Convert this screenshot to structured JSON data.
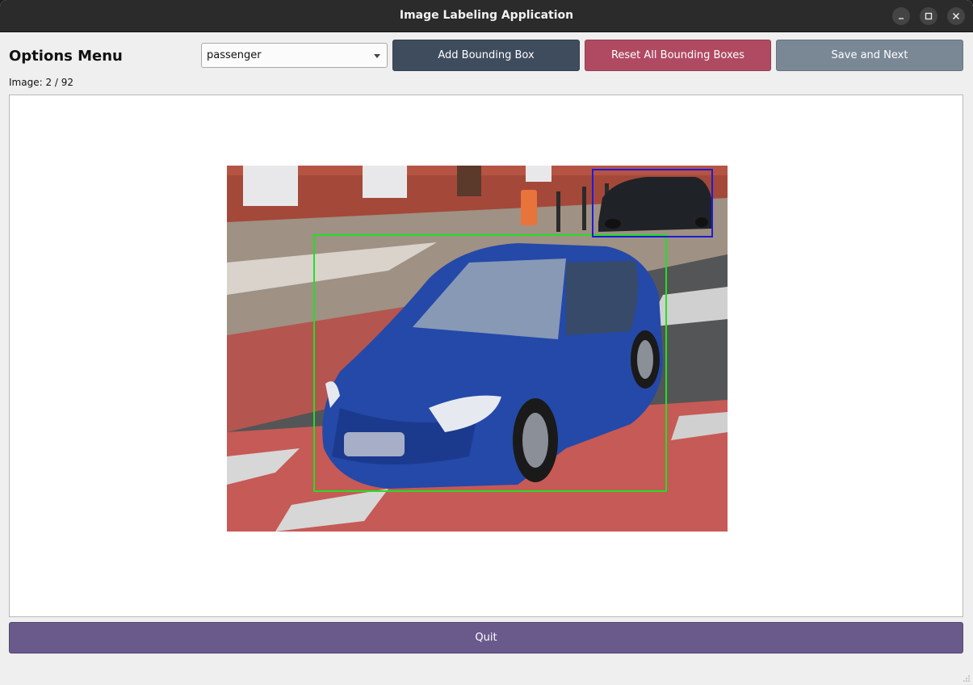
{
  "window": {
    "title": "Image Labeling Application",
    "controls": [
      "minimize-icon",
      "maximize-icon",
      "close-icon"
    ]
  },
  "header": {
    "title": "Options Menu",
    "image_counter": "Image: 2 / 92"
  },
  "class_select": {
    "selected": "passenger"
  },
  "buttons": {
    "add": "Add Bounding Box",
    "reset": "Reset All Bounding Boxes",
    "save": "Save and Next",
    "quit": "Quit"
  },
  "colors": {
    "add_button": "#3e4c5e",
    "reset_button": "#b04a62",
    "save_button": "#7a8896",
    "quit_button": "#6a5a8c",
    "bbox_green": "#22e022",
    "bbox_blue": "#1c1cdc"
  },
  "annotations": [
    {
      "color": "green"
    },
    {
      "color": "blue"
    }
  ]
}
